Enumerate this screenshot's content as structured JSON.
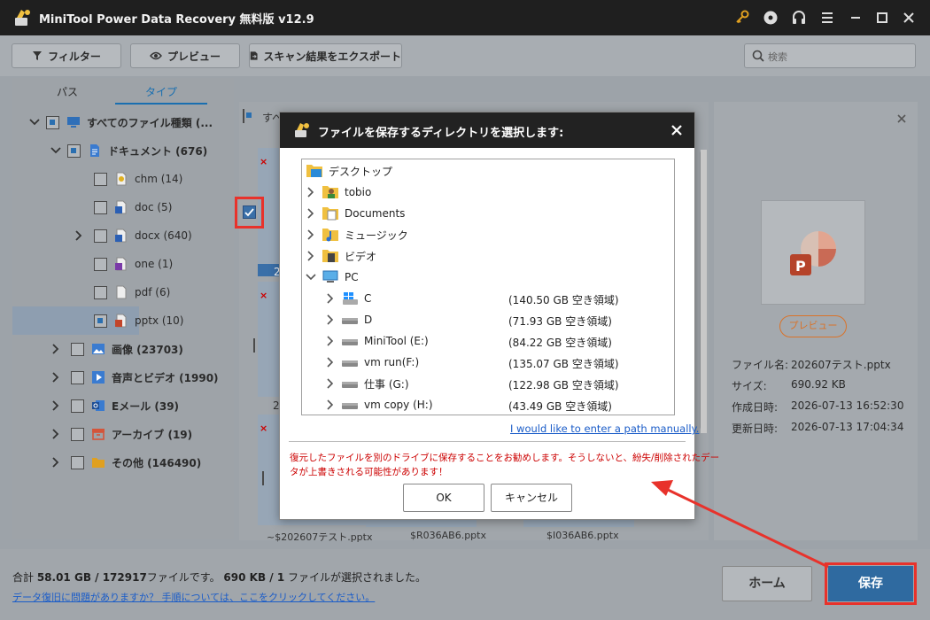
{
  "app": {
    "title": "MiniTool Power Data Recovery 無料版 v12.9"
  },
  "toolbar": {
    "filter_label": "フィルター",
    "preview_label": "プレビュー",
    "export_label": "スキャン結果をエクスポート",
    "search_placeholder": "検索"
  },
  "left_tabs": {
    "path": "パス",
    "type": "タイプ"
  },
  "tree": {
    "all": "すべてのファイル種類 (...",
    "documents": "ドキュメント (676)",
    "chm": "chm (14)",
    "doc": "doc (5)",
    "docx": "docx (640)",
    "one": "one (1)",
    "pdf": "pdf (6)",
    "pptx": "pptx (10)",
    "images": "画像 (23703)",
    "audio_video": "音声とビデオ (1990)",
    "email": "Eメール (39)",
    "archive": "アーカイブ (19)",
    "other": "その他 (146490)"
  },
  "middle": {
    "select_all": "すべ",
    "thumb_label_1": "2",
    "thumb_label_2": "2",
    "filenames": [
      "~$202607テスト.pptx",
      "$R036AB6.pptx",
      "$I036AB6.pptx"
    ]
  },
  "preview": {
    "button": "プレビュー",
    "labels": {
      "name": "ファイル名:",
      "size": "サイズ:",
      "created": "作成日時:",
      "modified": "更新日時:"
    },
    "values": {
      "name": "202607テスト.pptx",
      "size": "690.92 KB",
      "created": "2026-07-13 16:52:30",
      "modified": "2026-07-13 17:04:34"
    }
  },
  "status": {
    "total_prefix": "合計 ",
    "total_value": "58.01 GB / 172917",
    "total_mid": "ファイルです。 ",
    "selected_value": "690 KB / 1",
    "selected_suffix": " ファイルが選択されました。",
    "help_link": "データ復旧に問題がありますか？ 手順については、ここをクリックしてください。"
  },
  "bottom_buttons": {
    "home": "ホーム",
    "save": "保存"
  },
  "dialog": {
    "title": "ファイルを保存するディレクトリを選択します:",
    "tree": {
      "desktop": "デスクトップ",
      "tobio": "tobio",
      "documents": "Documents",
      "music": "ミュージック",
      "video": "ビデオ",
      "pc": "PC"
    },
    "drives": [
      {
        "name": "C",
        "free": "(140.50 GB 空き領域)"
      },
      {
        "name": "D",
        "free": "(71.93 GB 空き領域)"
      },
      {
        "name": "MiniTool (E:)",
        "free": "(84.22 GB 空き領域)"
      },
      {
        "name": "vm run(F:)",
        "free": "(135.07 GB 空き領域)"
      },
      {
        "name": "仕事 (G:)",
        "free": "(122.98 GB 空き領域)"
      },
      {
        "name": "vm copy (H:)",
        "free": "(43.49 GB 空き領域)"
      }
    ],
    "manual_link": "I would like to enter a path manually.",
    "warning_line1": "復元したファイルを別のドライブに保存することをお勧めします。そうしないと、紛失/削除されたデー",
    "warning_line2": "タが上書きされる可能性があります！",
    "ok": "OK",
    "cancel": "キャンセル"
  },
  "colors": {
    "accent": "#1a6fb0",
    "highlight": "#e8322b",
    "warning_text": "#cc0000",
    "link": "#1a5cc8",
    "preview_orange": "#d9732a"
  }
}
